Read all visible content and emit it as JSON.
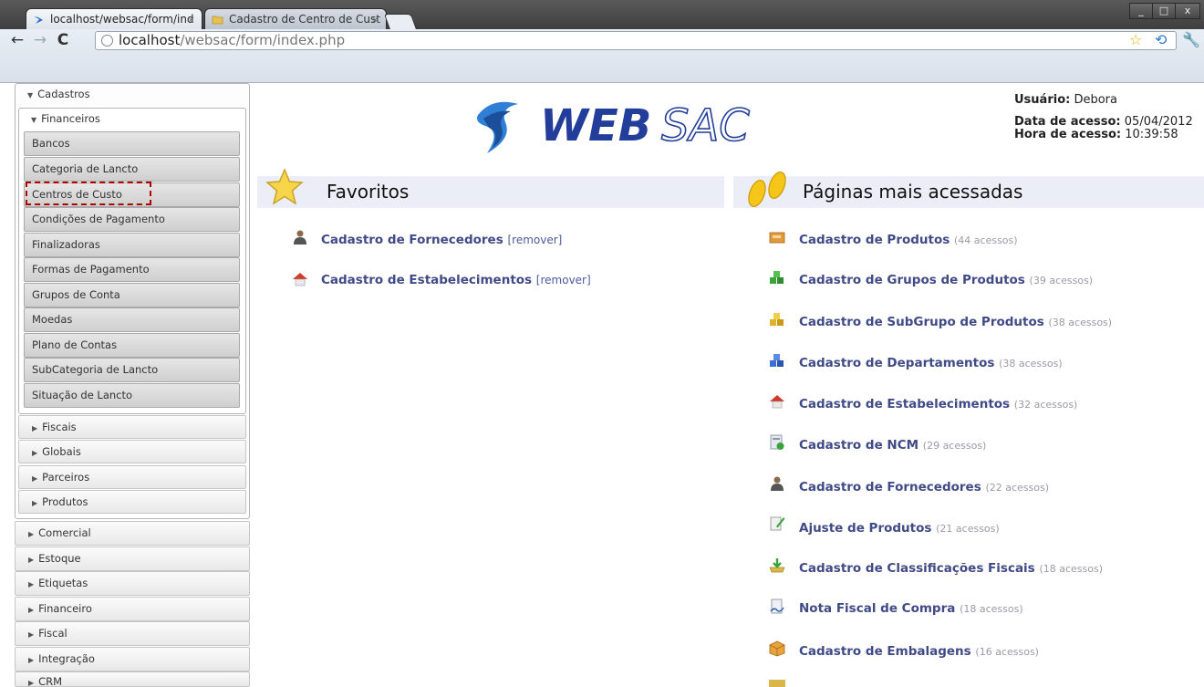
{
  "browser": {
    "tabs": [
      {
        "label": "localhost/websac/form/ind",
        "close": "×"
      },
      {
        "label": "Cadastro de Centro de Cust",
        "close": "×"
      }
    ],
    "url_host": "localhost",
    "url_path": "/websac/form/index.php",
    "window_buttons": {
      "minimize": "_",
      "maximize": "□",
      "close": "x"
    }
  },
  "sidebar": {
    "cadastros": "Cadastros",
    "financeiros": "Financeiros",
    "financeiros_items": [
      "Bancos",
      "Categoria de Lancto",
      "Centros de Custo",
      "Condições de Pagamento",
      "Finalizadoras",
      "Formas de Pagamento",
      "Grupos de Conta",
      "Moedas",
      "Plano de Contas",
      "SubCategoria de Lancto",
      "Situação de Lancto"
    ],
    "cadastros_groups": [
      "Fiscais",
      "Globais",
      "Parceiros",
      "Produtos"
    ],
    "modules": [
      "Comercial",
      "Estoque",
      "Etiquetas",
      "Financeiro",
      "Fiscal",
      "Integração",
      "CRM"
    ]
  },
  "logo": {
    "text1": "WEB",
    "text2": "SAC"
  },
  "user": {
    "user_label": "Usuário:",
    "user_name": "Debora",
    "date_label": "Data de acesso:",
    "date_value": "05/04/2012",
    "time_label": "Hora de acesso:",
    "time_value": "10:39:58"
  },
  "favorites": {
    "title": "Favoritos",
    "items": [
      {
        "label": "Cadastro de Fornecedores",
        "action": "[remover]",
        "icon": "person-icon"
      },
      {
        "label": "Cadastro de Estabelecimentos",
        "action": "[remover]",
        "icon": "house-icon"
      }
    ]
  },
  "popular": {
    "title": "Páginas mais acessadas",
    "items": [
      {
        "label": "Cadastro de Produtos",
        "count": "(44 acessos)",
        "icon": "box-card-icon"
      },
      {
        "label": "Cadastro de Grupos de Produtos",
        "count": "(39 acessos)",
        "icon": "green-cubes-icon"
      },
      {
        "label": "Cadastro de SubGrupo de Produtos",
        "count": "(38 acessos)",
        "icon": "yellow-cubes-icon"
      },
      {
        "label": "Cadastro de Departamentos",
        "count": "(38 acessos)",
        "icon": "blue-cubes-icon"
      },
      {
        "label": "Cadastro de Estabelecimentos",
        "count": "(32 acessos)",
        "icon": "house-icon"
      },
      {
        "label": "Cadastro de NCM",
        "count": "(29 acessos)",
        "icon": "ncm-doc-icon"
      },
      {
        "label": "Cadastro de Fornecedores",
        "count": "(22 acessos)",
        "icon": "person-icon"
      },
      {
        "label": "Ajuste de Produtos",
        "count": "(21 acessos)",
        "icon": "pencil-doc-icon"
      },
      {
        "label": "Cadastro de Classificações Fiscais",
        "count": "(18 acessos)",
        "icon": "tray-arrow-icon"
      },
      {
        "label": "Nota Fiscal de Compra",
        "count": "(18 acessos)",
        "icon": "signed-doc-icon"
      },
      {
        "label": "Cadastro de Embalagens",
        "count": "(16 acessos)",
        "icon": "package-icon"
      }
    ]
  },
  "colors": {
    "link": "#3f4a86",
    "section_bg": "#eceef7",
    "highlight": "#b00000"
  }
}
